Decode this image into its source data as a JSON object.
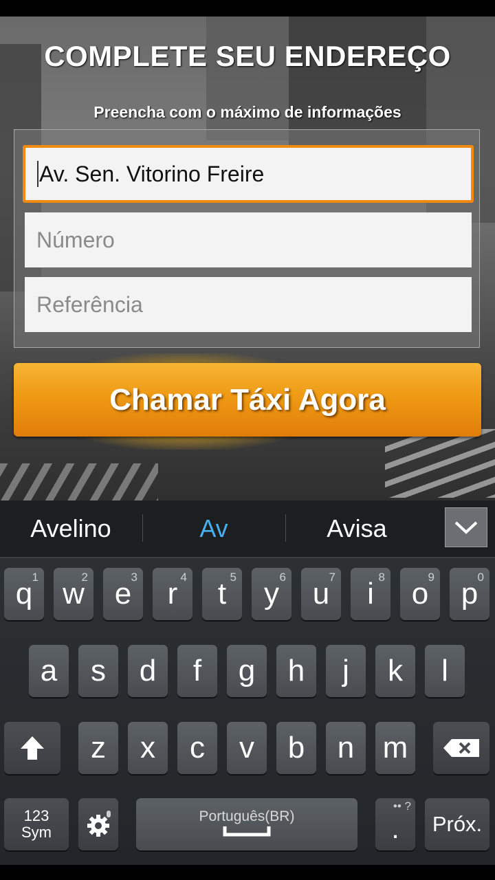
{
  "header": {
    "title": "COMPLETE SEU ENDEREÇO",
    "subtitle": "Preencha com o máximo de informações"
  },
  "form": {
    "street_value": "Av. Sen. Vitorino Freire",
    "number_placeholder": "Número",
    "reference_placeholder": "Referência"
  },
  "cta": {
    "label": "Chamar Táxi Agora"
  },
  "keyboard": {
    "suggestions": [
      "Avelino",
      "Av",
      "Avisa"
    ],
    "row1": [
      {
        "k": "q",
        "n": "1"
      },
      {
        "k": "w",
        "n": "2"
      },
      {
        "k": "e",
        "n": "3"
      },
      {
        "k": "r",
        "n": "4"
      },
      {
        "k": "t",
        "n": "5"
      },
      {
        "k": "y",
        "n": "6"
      },
      {
        "k": "u",
        "n": "7"
      },
      {
        "k": "i",
        "n": "8"
      },
      {
        "k": "o",
        "n": "9"
      },
      {
        "k": "p",
        "n": "0"
      }
    ],
    "row2": [
      "a",
      "s",
      "d",
      "f",
      "g",
      "h",
      "j",
      "k",
      "l"
    ],
    "row3": [
      "z",
      "x",
      "c",
      "v",
      "b",
      "n",
      "m"
    ],
    "sym_label_1": "123",
    "sym_label_2": "Sym",
    "space_label": "Português(BR)",
    "period_label": ".",
    "period_hint": "•• ?",
    "next_label": "Próx."
  },
  "colors": {
    "accent": "#f08a10",
    "suggestion_active": "#45b1ee"
  }
}
